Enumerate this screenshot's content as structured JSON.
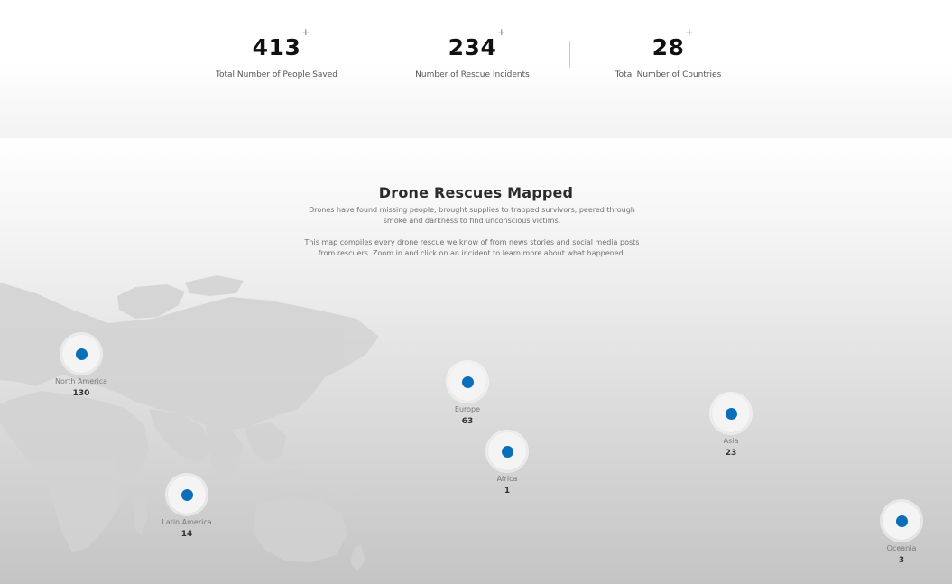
{
  "stats": [
    {
      "value": "413",
      "plus": "+",
      "label": "Total Number of People Saved"
    },
    {
      "value": "234",
      "plus": "+",
      "label": "Number of Rescue Incidents"
    },
    {
      "value": "28",
      "plus": "+",
      "label": "Total Number of Countries"
    }
  ],
  "map": {
    "title": "Drone Rescues Mapped",
    "description_1": "Drones have found missing people, brought supplies to trapped survivors, peered through smoke and darkness to find unconscious victims.",
    "description_2": "This map compiles every drone rescue we know of from news stories and social media posts from rescuers. Zoom in and click on an incident to learn more about what happened."
  },
  "regions": [
    {
      "name": "North America",
      "count": "130"
    },
    {
      "name": "Latin America",
      "count": "14"
    },
    {
      "name": "Europe",
      "count": "63"
    },
    {
      "name": "Africa",
      "count": "1"
    },
    {
      "name": "Asia",
      "count": "23"
    },
    {
      "name": "Oceania",
      "count": "3"
    }
  ],
  "colors": {
    "marker_dot": "#0a6fb8",
    "land": "#d2d2d2"
  }
}
